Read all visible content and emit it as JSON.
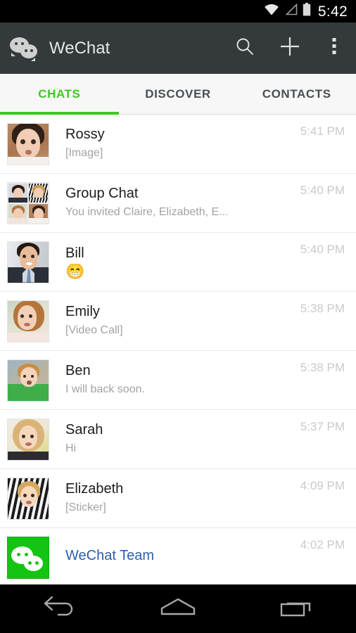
{
  "status_bar": {
    "clock": "5:42",
    "icons": [
      "wifi-icon",
      "signal-icon",
      "battery-icon"
    ]
  },
  "app_bar": {
    "logo": "wechat-logo",
    "title": "WeChat",
    "actions": [
      {
        "name": "search-icon",
        "label": "Search"
      },
      {
        "name": "plus-icon",
        "label": "Add"
      },
      {
        "name": "overflow-menu-icon",
        "label": "More options"
      }
    ],
    "background": "#343a3c"
  },
  "tabs": {
    "active_index": 0,
    "accent": "#3dc821",
    "items": [
      {
        "label": "CHATS"
      },
      {
        "label": "DISCOVER"
      },
      {
        "label": "CONTACTS"
      }
    ]
  },
  "chats": [
    {
      "name": "Rossy",
      "message": "[Image]",
      "time": "5:41 PM",
      "avatar": "rossy",
      "name_color": "dark",
      "message_kind": "text"
    },
    {
      "name": "Group Chat",
      "message": "You invited Claire, Elizabeth, E...",
      "time": "5:40 PM",
      "avatar": "group",
      "name_color": "dark",
      "message_kind": "text"
    },
    {
      "name": "Bill",
      "message": "😁",
      "time": "5:40 PM",
      "avatar": "bill",
      "name_color": "dark",
      "message_kind": "emoji"
    },
    {
      "name": "Emily",
      "message": "[Video Call]",
      "time": "5:38 PM",
      "avatar": "emily",
      "name_color": "dark",
      "message_kind": "text"
    },
    {
      "name": "Ben",
      "message": "I will back  soon.",
      "time": "5:38 PM",
      "avatar": "ben",
      "name_color": "dark",
      "message_kind": "text"
    },
    {
      "name": "Sarah",
      "message": "Hi",
      "time": "5:37 PM",
      "avatar": "sarah",
      "name_color": "dark",
      "message_kind": "text"
    },
    {
      "name": "Elizabeth",
      "message": "[Sticker]",
      "time": "4:09 PM",
      "avatar": "elizabeth",
      "name_color": "dark",
      "message_kind": "text"
    },
    {
      "name": "WeChat Team",
      "message": "",
      "time": "4:02 PM",
      "avatar": "team",
      "name_color": "link",
      "message_kind": "text"
    }
  ],
  "nav_bar": {
    "buttons": [
      {
        "name": "back-button",
        "label": "Back"
      },
      {
        "name": "home-button",
        "label": "Home"
      },
      {
        "name": "recents-button",
        "label": "Recent apps"
      }
    ]
  },
  "colors": {
    "accent_green": "#3dc821",
    "app_bar": "#343a3c",
    "link_blue": "#2d5fa6",
    "timestamp_gray": "#cacaca",
    "subtitle_gray": "#a3a3a3"
  }
}
